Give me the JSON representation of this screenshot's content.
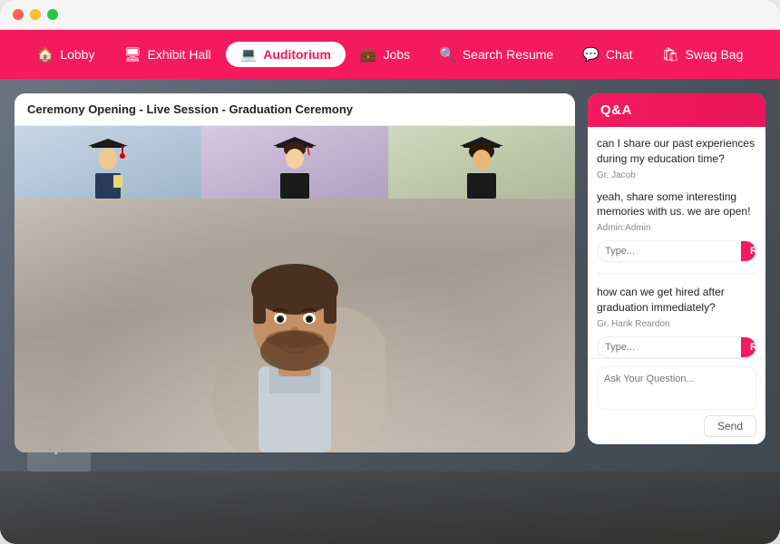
{
  "window": {
    "dots": [
      "red",
      "yellow",
      "green"
    ]
  },
  "nav": {
    "items": [
      {
        "id": "lobby",
        "label": "Lobby",
        "icon": "🏠",
        "active": false
      },
      {
        "id": "exhibit-hall",
        "label": "Exhibit Hall",
        "icon": "🖥",
        "active": false
      },
      {
        "id": "auditorium",
        "label": "Auditorium",
        "icon": "💻",
        "active": true
      },
      {
        "id": "jobs",
        "label": "Jobs",
        "icon": "💼",
        "active": false
      },
      {
        "id": "search-resume",
        "label": "Search Resume",
        "icon": "🔍",
        "active": false
      },
      {
        "id": "chat",
        "label": "Chat",
        "icon": "💬",
        "active": false
      },
      {
        "id": "swag-bag",
        "label": "Swag Bag",
        "icon": "🛍",
        "active": false
      }
    ]
  },
  "video": {
    "session_title": "Ceremony Opening - Live Session - Graduation Ceremony",
    "thumbnails": [
      {
        "label": "Graduate 1"
      },
      {
        "label": "Graduate 2"
      },
      {
        "label": "Graduate 3"
      }
    ],
    "main_label": "Speaker"
  },
  "qa": {
    "header": "Q&A",
    "questions": [
      {
        "id": "q1",
        "text": "can I share our past experiences during my education time?",
        "author": "Gr. Jacob",
        "reply_placeholder": "Type...",
        "reply_label": "Reply"
      },
      {
        "id": "q2",
        "text": "yeah, share some interesting memories with us. we are open!",
        "author": "Admin:Admin",
        "reply_placeholder": "Type...",
        "reply_label": "Reply"
      },
      {
        "id": "q3",
        "text": "how can we get hired after graduation immediately?",
        "author": "Gr. Hank Reardon",
        "reply_placeholder": "Type...",
        "reply_label": "Reply"
      }
    ],
    "ask_placeholder": "Ask Your Question...",
    "send_label": "Send"
  }
}
